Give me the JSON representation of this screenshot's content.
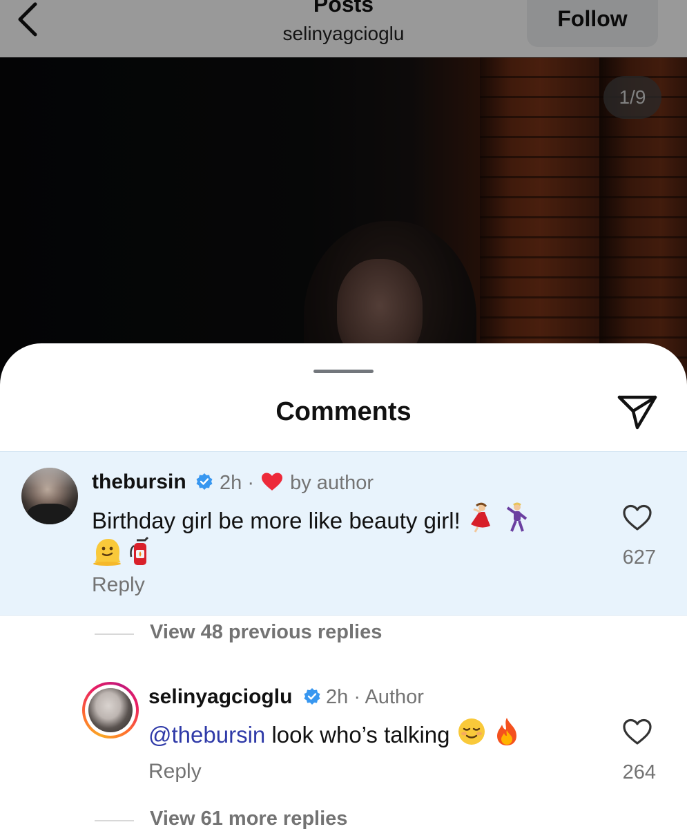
{
  "header": {
    "title": "Posts",
    "subtitle": "selinyagcioglu",
    "follow_label": "Follow",
    "image_counter": "1/9"
  },
  "sheet": {
    "title": "Comments"
  },
  "comments": [
    {
      "username": "thebursin",
      "verified": true,
      "time": "2h",
      "separator": "·",
      "liked_by_author_label": "by author",
      "text": "Birthday girl be more like beauty girl!",
      "text_emojis": [
        "dancer",
        "man-dancing",
        "melting-face",
        "fire-extinguisher"
      ],
      "reply_label": "Reply",
      "likes": "627"
    },
    {
      "username": "selinyagcioglu",
      "verified": true,
      "time": "2h",
      "separator": "·",
      "author_badge": "Author",
      "mention": "@thebursin",
      "text": "look who’s talking",
      "text_emojis": [
        "relieved-face",
        "fire"
      ],
      "reply_label": "Reply",
      "likes": "264"
    }
  ],
  "threads": {
    "view_previous": "View 48 previous replies",
    "view_more": "View 61 more replies"
  },
  "colors": {
    "highlight_bg": "#e8f3fc",
    "verified_blue": "#3897f0",
    "heart_red": "#ed2939",
    "mention_blue": "#2f3aa8",
    "secondary_text": "#737373"
  }
}
